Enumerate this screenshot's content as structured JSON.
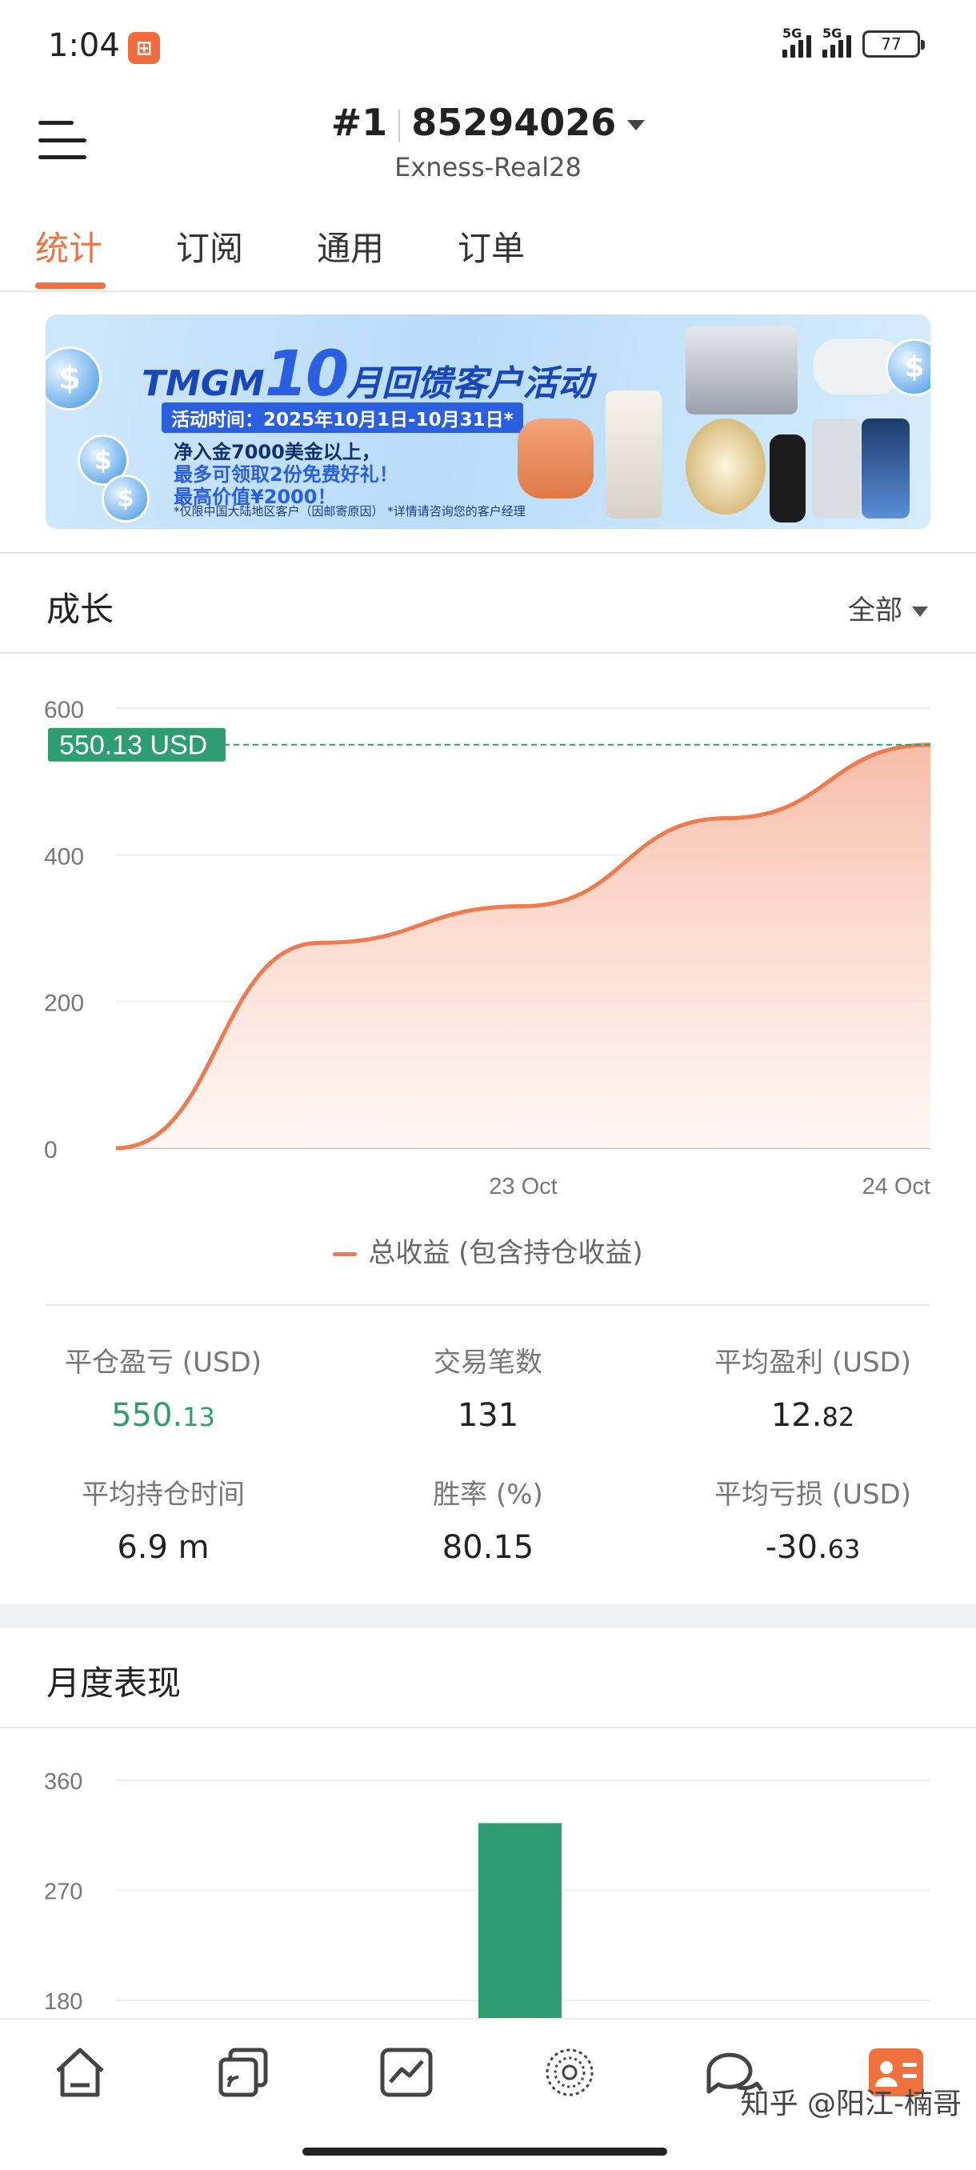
{
  "status_bar": {
    "time": "1:04",
    "network": [
      "5G",
      "5G"
    ],
    "battery": "77"
  },
  "header": {
    "account_no": "#1",
    "account_id": "85294026",
    "server": "Exness-Real28"
  },
  "tabs": [
    {
      "label": "统计",
      "active": true
    },
    {
      "label": "订阅",
      "active": false
    },
    {
      "label": "通用",
      "active": false
    },
    {
      "label": "订单",
      "active": false
    }
  ],
  "banner": {
    "brand": "TMGM",
    "month": "10",
    "title_tail": "月回馈客户活动",
    "date": "活动时间：2025年10月1日-10月31日*",
    "line1": "净入金7000美金以上，",
    "line2": "最多可领取2份免费好礼！",
    "line3": "最高价值¥2000！",
    "fine_print": "*仅限中国大陆地区客户（因邮寄原因） *详情请咨询您的客户经理"
  },
  "growth": {
    "title": "成长",
    "range": "全部",
    "legend": "总收益 (包含持仓收益)",
    "current_label": "550.13 USD"
  },
  "chart_data": [
    {
      "type": "area",
      "x": [
        "",
        "",
        "23 Oct",
        "",
        "24 Oct"
      ],
      "x_ticks": [
        "23 Oct",
        "24 Oct"
      ],
      "y_ticks": [
        "0",
        "200",
        "400",
        "600"
      ],
      "ylim": [
        0,
        600
      ],
      "series": [
        {
          "name": "总收益 (包含持仓收益)",
          "values": [
            0,
            280,
            330,
            450,
            550.13
          ]
        }
      ],
      "current_value": 550.13,
      "color": "#ee7a4d",
      "fill_color": "#f7b9a2",
      "marker_color": "#2e9e72"
    },
    {
      "type": "bar",
      "y_ticks": [
        "180",
        "270",
        "360"
      ],
      "values": [
        325
      ],
      "color": "#2e9e72"
    }
  ],
  "stats": [
    {
      "label": "平仓盈亏 (USD)",
      "value_main": "550.",
      "value_small": "13",
      "color": "#2e9e72"
    },
    {
      "label": "交易笔数",
      "value_main": "131",
      "value_small": ""
    },
    {
      "label": "平均盈利 (USD)",
      "value_main": "12.",
      "value_small": "82"
    },
    {
      "label": "平均持仓时间",
      "value_main": "6.9 m",
      "value_small": ""
    },
    {
      "label": "胜率 (%)",
      "value_main": "80.15",
      "value_small": ""
    },
    {
      "label": "平均亏损 (USD)",
      "value_main": "-30.",
      "value_small": "63"
    }
  ],
  "monthly": {
    "title": "月度表现"
  },
  "bottom_nav": [
    "home-icon",
    "copy-trading-icon",
    "chart-icon",
    "discover-icon",
    "chat-icon",
    "profile-icon"
  ],
  "watermark": "知乎 @阳江-楠哥"
}
